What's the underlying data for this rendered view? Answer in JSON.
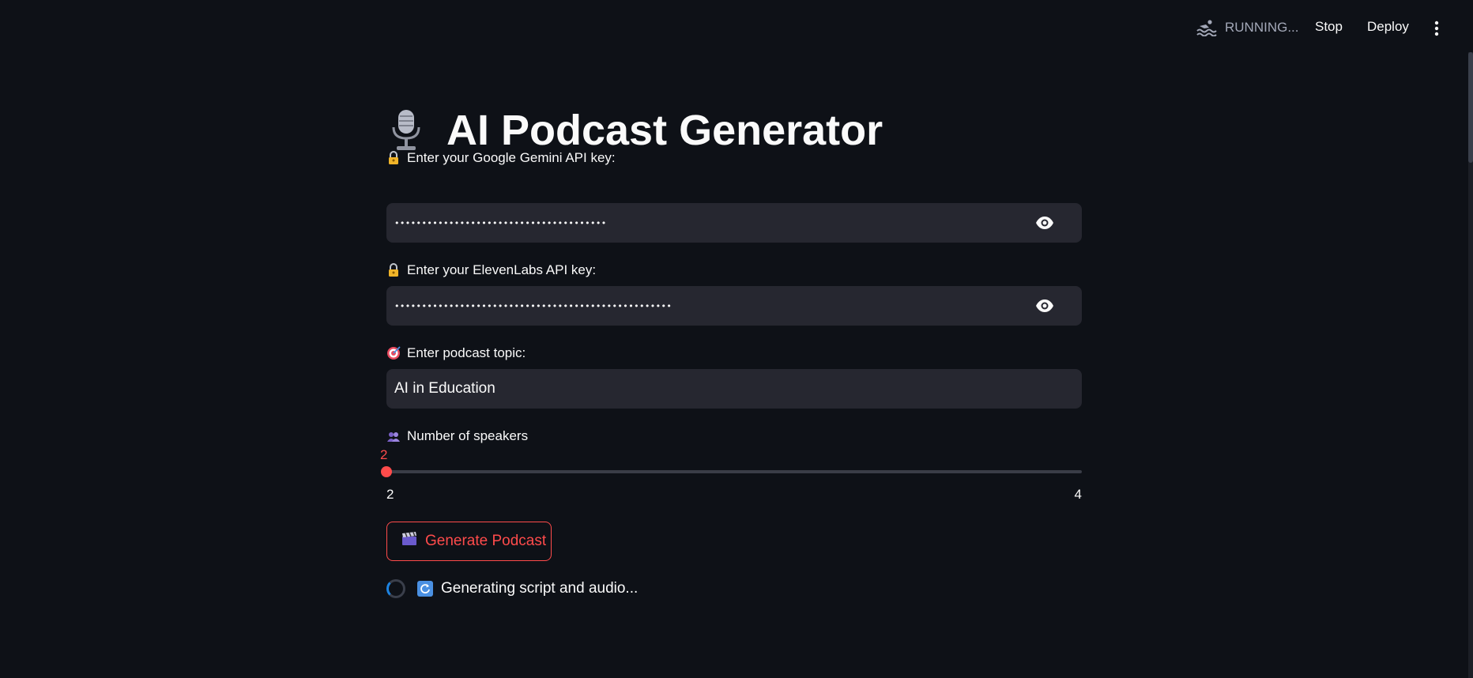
{
  "header": {
    "status_text": "RUNNING...",
    "stop_label": "Stop",
    "deploy_label": "Deploy",
    "status_icon": "swimmer-icon",
    "menu_icon": "kebab-menu-icon"
  },
  "app": {
    "title": "AI Podcast Generator",
    "title_icon": "microphone-icon"
  },
  "form": {
    "gemini": {
      "label": "Enter your Google Gemini API key:",
      "label_icon": "lock-with-key-icon",
      "value_masked": "•••••••••••••••••••••••••••••••••••••••",
      "toggle_icon": "eye-icon"
    },
    "elevenlabs": {
      "label": "Enter your ElevenLabs API key:",
      "label_icon": "lock-with-key-icon",
      "value_masked": "•••••••••••••••••••••••••••••••••••••••••••••••••••",
      "toggle_icon": "eye-icon"
    },
    "topic": {
      "label": "Enter podcast topic:",
      "label_icon": "direct-hit-icon",
      "value": "AI in Education"
    },
    "speakers": {
      "label": "Number of speakers",
      "label_icon": "busts-icon",
      "value": "2",
      "min": "2",
      "max": "4"
    },
    "generate_button": {
      "label": "Generate Podcast",
      "icon": "clapper-board-icon"
    }
  },
  "status": {
    "text": "Generating script and audio...",
    "icon": "refresh-icon"
  },
  "colors": {
    "background": "#0e1117",
    "input_bg": "#262730",
    "accent": "#ff4b4b",
    "text": "#fafafa"
  }
}
